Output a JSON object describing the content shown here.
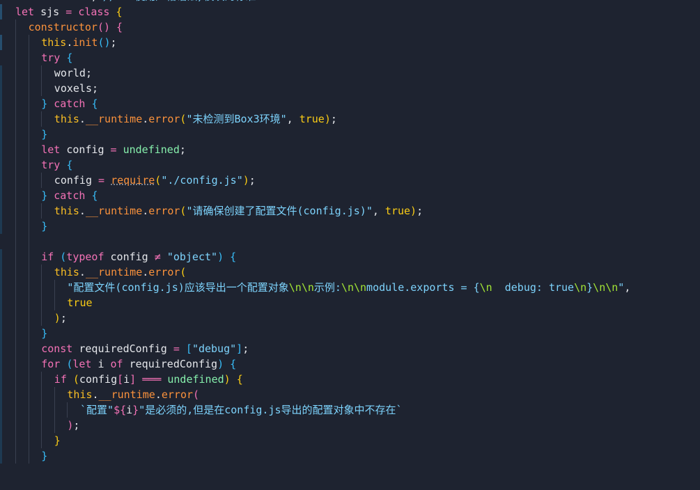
{
  "editor": {
    "language": "javascript",
    "theme_colors": {
      "background": "#1e2330",
      "keyword": "#f472b6",
      "string": "#7dd3fc",
      "this": "#fbbf24",
      "function": "#fb923c",
      "boolean": "#facc15",
      "undefined": "#86efac"
    },
    "lines": [
      {
        "indent": 0,
        "gutter": "none",
        "tokens": [
          [
            "str",
            "\"use strict\""
          ],
          [
            "id",
            "; "
          ],
          [
            "com",
            "// * 使用严格语法,模块的标准"
          ]
        ]
      },
      {
        "indent": 0,
        "gutter": "strong",
        "tokens": [
          [
            "kw",
            "let "
          ],
          [
            "id",
            "sjs "
          ],
          [
            "op",
            "= "
          ],
          [
            "cls",
            "class "
          ],
          [
            "p1",
            "{"
          ]
        ]
      },
      {
        "indent": 1,
        "gutter": "none",
        "tokens": [
          [
            "ctor",
            "constructor"
          ],
          [
            "p2",
            "() "
          ],
          [
            "p2",
            "{"
          ]
        ]
      },
      {
        "indent": 2,
        "gutter": "strong",
        "tokens": [
          [
            "this",
            "this"
          ],
          [
            "id",
            "."
          ],
          [
            "fn",
            "init"
          ],
          [
            "p3",
            "()"
          ],
          [
            "id",
            ";"
          ]
        ]
      },
      {
        "indent": 2,
        "gutter": "none",
        "tokens": [
          [
            "kw",
            "try "
          ],
          [
            "p3",
            "{"
          ]
        ]
      },
      {
        "indent": 3,
        "gutter": "normal",
        "tokens": [
          [
            "id",
            "world;"
          ]
        ]
      },
      {
        "indent": 3,
        "gutter": "normal",
        "tokens": [
          [
            "id",
            "voxels;"
          ]
        ]
      },
      {
        "indent": 2,
        "gutter": "normal",
        "tokens": [
          [
            "p3",
            "} "
          ],
          [
            "kw",
            "catch "
          ],
          [
            "p3",
            "{"
          ]
        ]
      },
      {
        "indent": 3,
        "gutter": "normal",
        "tokens": [
          [
            "this",
            "this"
          ],
          [
            "id",
            "."
          ],
          [
            "fn",
            "__runtime"
          ],
          [
            "id",
            "."
          ],
          [
            "fn",
            "error"
          ],
          [
            "p1",
            "("
          ],
          [
            "str",
            "\"未检测到Box3环境\""
          ],
          [
            "id",
            ", "
          ],
          [
            "bool",
            "true"
          ],
          [
            "p1",
            ")"
          ],
          [
            "id",
            ";"
          ]
        ]
      },
      {
        "indent": 2,
        "gutter": "normal",
        "tokens": [
          [
            "p3",
            "}"
          ]
        ]
      },
      {
        "indent": 2,
        "gutter": "normal",
        "tokens": [
          [
            "kw",
            "let "
          ],
          [
            "id",
            "config "
          ],
          [
            "op",
            "= "
          ],
          [
            "undef",
            "undefined"
          ],
          [
            "id",
            ";"
          ]
        ]
      },
      {
        "indent": 2,
        "gutter": "normal",
        "tokens": [
          [
            "kw",
            "try "
          ],
          [
            "p3",
            "{"
          ]
        ]
      },
      {
        "indent": 3,
        "gutter": "normal",
        "tokens": [
          [
            "id",
            "config "
          ],
          [
            "op",
            "= "
          ],
          [
            "req",
            "require"
          ],
          [
            "p1",
            "("
          ],
          [
            "str",
            "\"./config.js\""
          ],
          [
            "p1",
            ")"
          ],
          [
            "id",
            ";"
          ]
        ]
      },
      {
        "indent": 2,
        "gutter": "normal",
        "tokens": [
          [
            "p3",
            "} "
          ],
          [
            "kw",
            "catch "
          ],
          [
            "p3",
            "{"
          ]
        ]
      },
      {
        "indent": 3,
        "gutter": "normal",
        "tokens": [
          [
            "this",
            "this"
          ],
          [
            "id",
            "."
          ],
          [
            "fn",
            "__runtime"
          ],
          [
            "id",
            "."
          ],
          [
            "fn",
            "error"
          ],
          [
            "p1",
            "("
          ],
          [
            "str",
            "\"请确保创建了配置文件(config.js)\""
          ],
          [
            "id",
            ", "
          ],
          [
            "bool",
            "true"
          ],
          [
            "p1",
            ")"
          ],
          [
            "id",
            ";"
          ]
        ]
      },
      {
        "indent": 2,
        "gutter": "normal",
        "tokens": [
          [
            "p3",
            "}"
          ]
        ]
      },
      {
        "indent": 2,
        "gutter": "none",
        "tokens": []
      },
      {
        "indent": 2,
        "gutter": "normal",
        "tokens": [
          [
            "kw",
            "if "
          ],
          [
            "p3",
            "("
          ],
          [
            "kw",
            "typeof "
          ],
          [
            "id",
            "config "
          ],
          [
            "op",
            "≠ "
          ],
          [
            "str",
            "\"object\""
          ],
          [
            "p3",
            ") "
          ],
          [
            "p3",
            "{"
          ]
        ]
      },
      {
        "indent": 3,
        "gutter": "normal",
        "tokens": [
          [
            "this",
            "this"
          ],
          [
            "id",
            "."
          ],
          [
            "fn",
            "__runtime"
          ],
          [
            "id",
            "."
          ],
          [
            "fn",
            "error"
          ],
          [
            "p1",
            "("
          ]
        ]
      },
      {
        "indent": 4,
        "gutter": "normal",
        "tokens": [
          [
            "str",
            "\"配置文件(config.js)应该导出一个配置对象"
          ],
          [
            "esc",
            "\\n\\n"
          ],
          [
            "str",
            "示例:"
          ],
          [
            "esc",
            "\\n\\n"
          ],
          [
            "str",
            "module.exports = {"
          ],
          [
            "esc",
            "\\n"
          ],
          [
            "str",
            "  debug: true"
          ],
          [
            "esc",
            "\\n"
          ],
          [
            "str",
            "}"
          ],
          [
            "esc",
            "\\n\\n"
          ],
          [
            "str",
            "\""
          ],
          [
            "id",
            ","
          ]
        ]
      },
      {
        "indent": 4,
        "gutter": "normal",
        "tokens": [
          [
            "bool",
            "true"
          ]
        ]
      },
      {
        "indent": 3,
        "gutter": "normal",
        "tokens": [
          [
            "p1",
            ")"
          ],
          [
            "id",
            ";"
          ]
        ]
      },
      {
        "indent": 2,
        "gutter": "normal",
        "tokens": [
          [
            "p3",
            "}"
          ]
        ]
      },
      {
        "indent": 2,
        "gutter": "normal",
        "tokens": [
          [
            "kw",
            "const "
          ],
          [
            "id",
            "requiredConfig "
          ],
          [
            "op",
            "= "
          ],
          [
            "p3",
            "["
          ],
          [
            "str",
            "\"debug\""
          ],
          [
            "p3",
            "]"
          ],
          [
            "id",
            ";"
          ]
        ]
      },
      {
        "indent": 2,
        "gutter": "normal",
        "tokens": [
          [
            "kw",
            "for "
          ],
          [
            "p3",
            "("
          ],
          [
            "kw",
            "let "
          ],
          [
            "id",
            "i "
          ],
          [
            "kw",
            "of "
          ],
          [
            "id",
            "requiredConfig"
          ],
          [
            "p3",
            ") "
          ],
          [
            "p3",
            "{"
          ]
        ]
      },
      {
        "indent": 3,
        "gutter": "normal",
        "tokens": [
          [
            "kw",
            "if "
          ],
          [
            "p1",
            "("
          ],
          [
            "id",
            "config"
          ],
          [
            "p2",
            "["
          ],
          [
            "id",
            "i"
          ],
          [
            "p2",
            "] "
          ],
          [
            "op",
            "═══ "
          ],
          [
            "undef",
            "undefined"
          ],
          [
            "p1",
            ") "
          ],
          [
            "p1",
            "{"
          ]
        ]
      },
      {
        "indent": 4,
        "gutter": "normal",
        "tokens": [
          [
            "this",
            "this"
          ],
          [
            "id",
            "."
          ],
          [
            "fn",
            "__runtime"
          ],
          [
            "id",
            "."
          ],
          [
            "fn",
            "error"
          ],
          [
            "p2",
            "("
          ]
        ]
      },
      {
        "indent": 5,
        "gutter": "normal",
        "tokens": [
          [
            "tmpl",
            "`配置\""
          ],
          [
            "kw",
            "${"
          ],
          [
            "id",
            "i"
          ],
          [
            "kw",
            "}"
          ],
          [
            "tmpl",
            "\"是必须的,但是在config.js导出的配置对象中不存在`"
          ]
        ]
      },
      {
        "indent": 4,
        "gutter": "normal",
        "tokens": [
          [
            "p2",
            ")"
          ],
          [
            "id",
            ";"
          ]
        ]
      },
      {
        "indent": 3,
        "gutter": "normal",
        "tokens": [
          [
            "p1",
            "}"
          ]
        ]
      },
      {
        "indent": 2,
        "gutter": "normal",
        "tokens": [
          [
            "p3",
            "}"
          ]
        ]
      }
    ]
  }
}
